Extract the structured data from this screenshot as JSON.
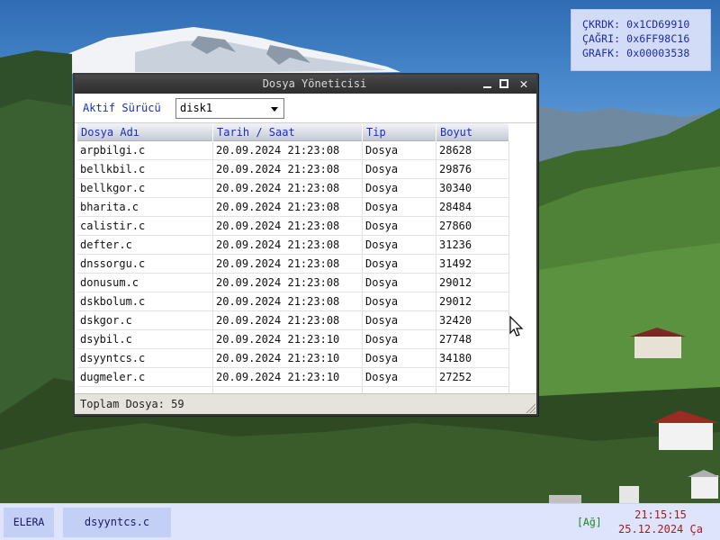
{
  "sysinfo": {
    "line1": "ÇKRDK: 0x1CD69910",
    "line2": "ÇAĞRI: 0x6FF98C16",
    "line3": "GRAFK: 0x00003538"
  },
  "window": {
    "title": "Dosya Yöneticisi",
    "minimize_label": "",
    "maximize_label": "",
    "close_label": "✕"
  },
  "drive": {
    "label": "Aktif Sürücü",
    "selected": "disk1"
  },
  "table": {
    "columns": [
      "Dosya Adı",
      "Tarih / Saat",
      "Tip",
      "Boyut"
    ],
    "rows": [
      [
        "arpbilgi.c",
        "20.09.2024 21:23:08",
        "Dosya",
        "28628"
      ],
      [
        "bellkbil.c",
        "20.09.2024 21:23:08",
        "Dosya",
        "29876"
      ],
      [
        "bellkgor.c",
        "20.09.2024 21:23:08",
        "Dosya",
        "30340"
      ],
      [
        "bharita.c",
        "20.09.2024 21:23:08",
        "Dosya",
        "28484"
      ],
      [
        "calistir.c",
        "20.09.2024 21:23:08",
        "Dosya",
        "27860"
      ],
      [
        "defter.c",
        "20.09.2024 21:23:08",
        "Dosya",
        "31236"
      ],
      [
        "dnssorgu.c",
        "20.09.2024 21:23:08",
        "Dosya",
        "31492"
      ],
      [
        "donusum.c",
        "20.09.2024 21:23:08",
        "Dosya",
        "29012"
      ],
      [
        "dskbolum.c",
        "20.09.2024 21:23:08",
        "Dosya",
        "29012"
      ],
      [
        "dskgor.c",
        "20.09.2024 21:23:08",
        "Dosya",
        "32420"
      ],
      [
        "dsybil.c",
        "20.09.2024 21:23:10",
        "Dosya",
        "27748"
      ],
      [
        "dsyyntcs.c",
        "20.09.2024 21:23:10",
        "Dosya",
        "34180"
      ],
      [
        "dugmeler.c",
        "20.09.2024 21:23:10",
        "Dosya",
        "27252"
      ],
      [
        "",
        "",
        "",
        ""
      ]
    ]
  },
  "status": {
    "text": "Toplam Dosya: 59"
  },
  "taskbar": {
    "start_label": "ELERA",
    "task_label": "dsyyntcs.c",
    "network": "[Ağ]",
    "time": "21:15:15",
    "date": "25.12.2024 Ça"
  },
  "colors": {
    "accent_text": "#1a2ec8",
    "titlebar": "#3a3a3a",
    "clock": "#b01818",
    "network": "#1a8a1a"
  },
  "icons": [
    "minimize-icon",
    "maximize-icon",
    "close-icon",
    "dropdown-arrow-icon",
    "resize-grip-icon",
    "mouse-cursor-icon"
  ]
}
